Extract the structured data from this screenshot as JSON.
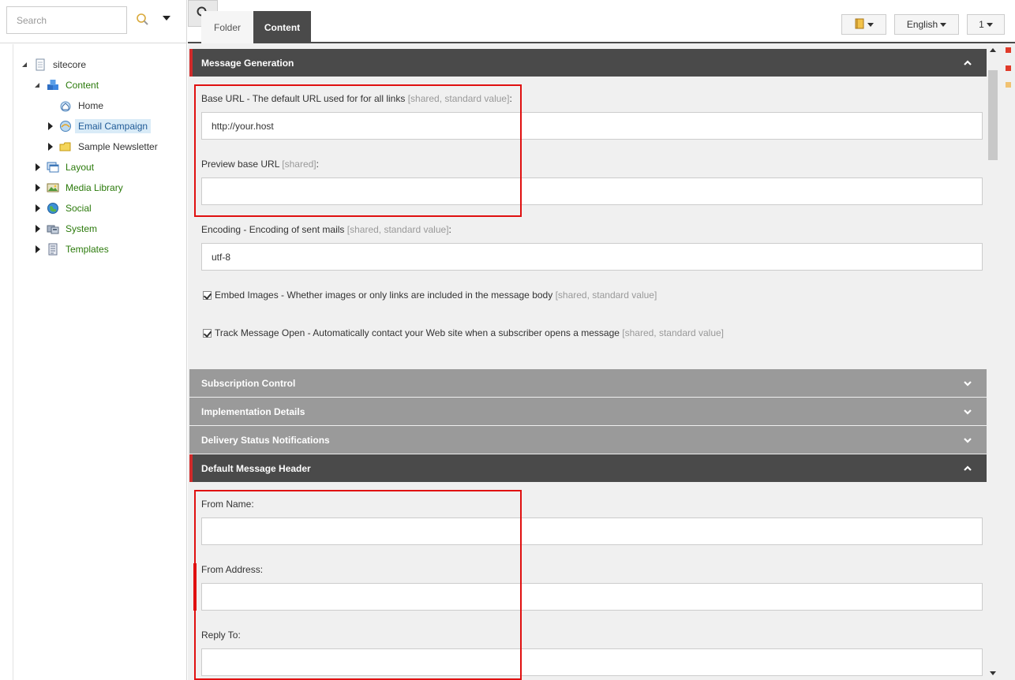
{
  "search": {
    "placeholder": "Search"
  },
  "tree": {
    "root": "sitecore",
    "items": [
      {
        "label": "Content"
      },
      {
        "label": "Home"
      },
      {
        "label": "Email Campaign"
      },
      {
        "label": "Sample Newsletter"
      },
      {
        "label": "Layout"
      },
      {
        "label": "Media Library"
      },
      {
        "label": "Social"
      },
      {
        "label": "System"
      },
      {
        "label": "Templates"
      }
    ]
  },
  "tabs": {
    "folder": "Folder",
    "content": "Content"
  },
  "toolbar": {
    "language": "English",
    "version": "1"
  },
  "sections": {
    "message_generation": {
      "title": "Message Generation",
      "base_url": {
        "label": "Base URL - The default URL used for for all links",
        "hint": "[shared, standard value]",
        "value": "http://your.host"
      },
      "preview_url": {
        "label": "Preview base URL",
        "hint": "[shared]",
        "value": ""
      },
      "encoding": {
        "label": "Encoding - Encoding of sent mails",
        "hint": "[shared, standard value]",
        "value": "utf-8"
      },
      "embed_images": {
        "label": "Embed Images - Whether images or only links are included in the message body",
        "hint": "[shared, standard value]",
        "checked": true
      },
      "track_open": {
        "label": "Track Message Open - Automatically contact your Web site when a subscriber opens a message",
        "hint": "[shared, standard value]",
        "checked": true
      }
    },
    "subscription_control": {
      "title": "Subscription Control"
    },
    "implementation_details": {
      "title": "Implementation Details"
    },
    "delivery_status": {
      "title": "Delivery Status Notifications"
    },
    "default_header": {
      "title": "Default Message Header",
      "from_name": {
        "label": "From Name:",
        "value": ""
      },
      "from_address": {
        "label": "From Address:",
        "value": ""
      },
      "reply_to": {
        "label": "Reply To:",
        "value": ""
      }
    }
  },
  "colors": {
    "accent_red": "#d12a2a",
    "header_dark": "#4a4a4a",
    "header_grey": "#9a9a9a",
    "tree_green": "#2b7a0b",
    "highlight_box": "#e01010"
  }
}
